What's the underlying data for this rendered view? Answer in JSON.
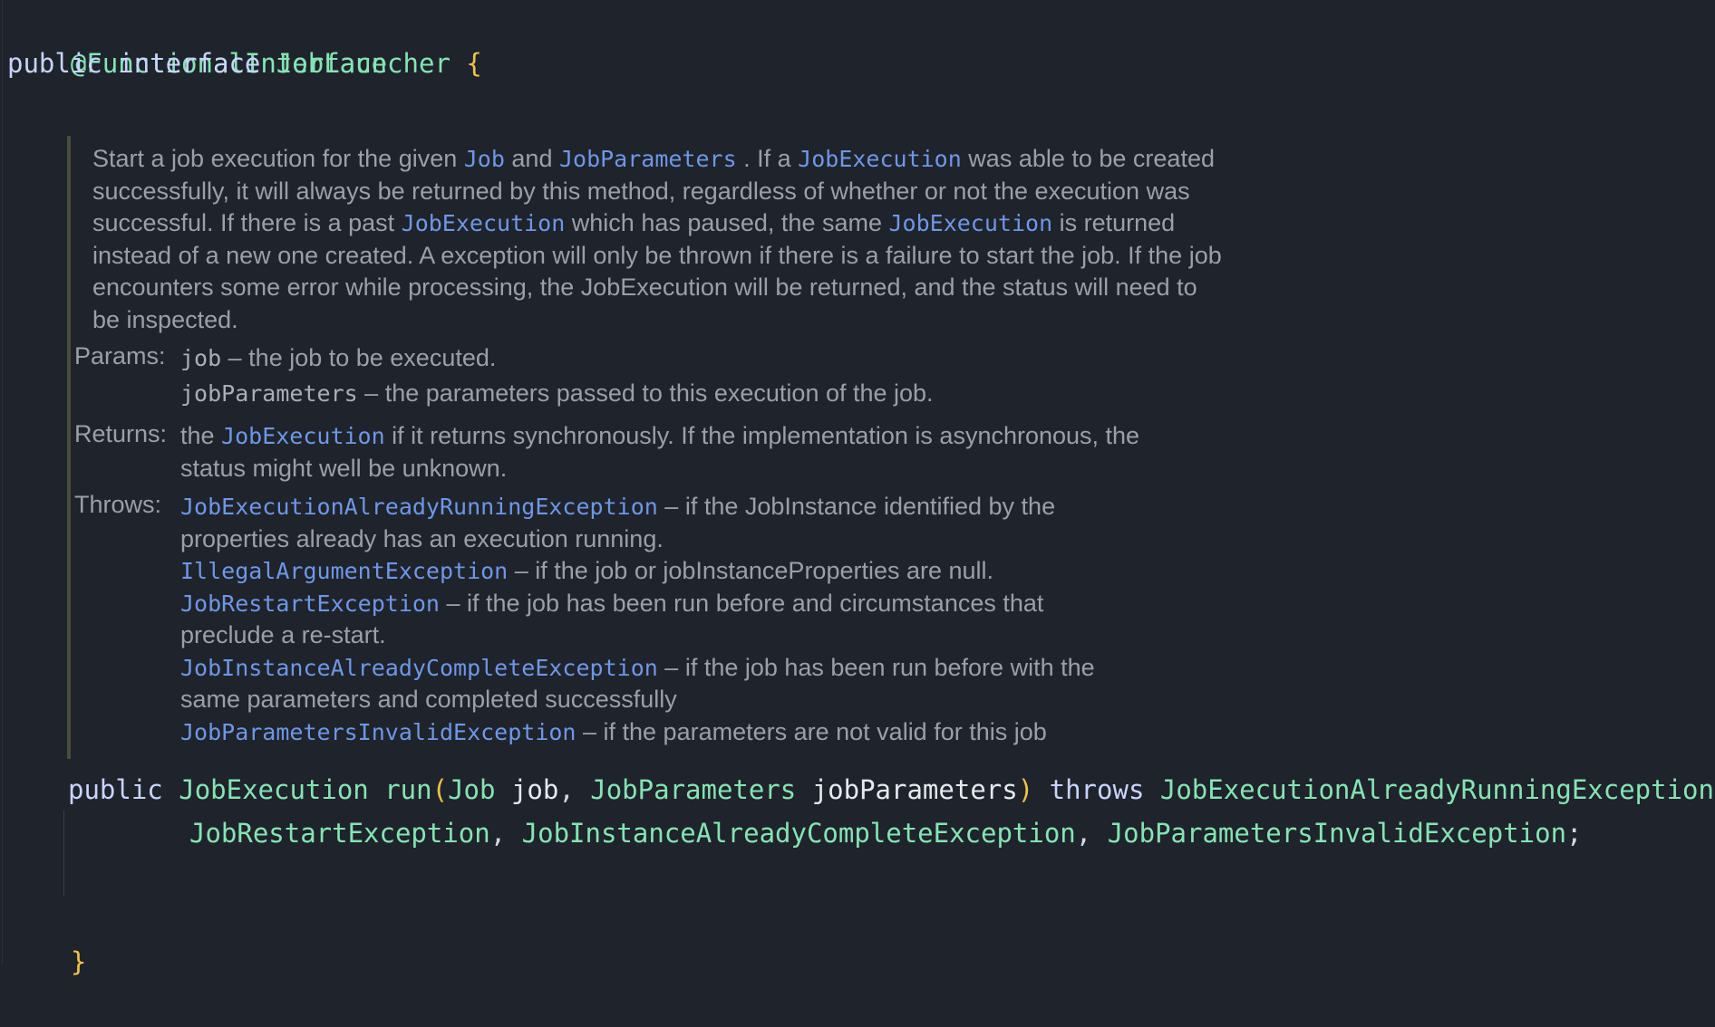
{
  "code": {
    "annotation": "@FunctionalInterface",
    "kw_public": "public",
    "kw_interface": "interface",
    "class_name": "JobLauncher",
    "open_brace": "{",
    "close_brace": "}",
    "method": {
      "kw_public": "public",
      "return_type": "JobExecution",
      "name": "run",
      "open_paren": "(",
      "param1_type": "Job",
      "param1_name": "job",
      "comma1": ",",
      "param2_type": "JobParameters",
      "param2_name": "jobParameters",
      "close_paren": ")",
      "kw_throws": "throws",
      "ex1": "JobExecutionAlreadyRunningException",
      "ex2": "JobRestartException",
      "ex3": "JobInstanceAlreadyCompleteException",
      "ex4": "JobParametersInvalidException",
      "comma": ",",
      "semicolon": ";"
    }
  },
  "doc": {
    "desc": {
      "t1": "Start a job execution for the given ",
      "l1": "Job",
      "t2": " and ",
      "l2": "JobParameters",
      "t3": " . If a ",
      "l3": "JobExecution",
      "t4": " was able to be created successfully, it will always be returned by this method, regardless of whether or not the execution was successful. If there is a past ",
      "l4": "JobExecution",
      "t5": " which has paused, the same ",
      "l5": "JobExecution",
      "t6": " is returned instead of a new one created. A exception will only be thrown if there is a failure to start the job. If the job encounters some error while processing, the JobExecution will be returned, and the status will need to be inspected."
    },
    "params": {
      "label": "Params:",
      "p1_name": "job",
      "p1_desc": " – the job to be executed.",
      "p2_name": "jobParameters",
      "p2_desc": " – the parameters passed to this execution of the job."
    },
    "returns": {
      "label": "Returns:",
      "t1": "the ",
      "link": "JobExecution",
      "t2": " if it returns synchronously. If the implementation is asynchronous, the status might well be unknown."
    },
    "throws": {
      "label": "Throws:",
      "items": [
        {
          "name": "JobExecutionAlreadyRunningException",
          "desc": " – if the JobInstance identified by the properties already has an execution running."
        },
        {
          "name": "IllegalArgumentException",
          "desc": " – if the job or jobInstanceProperties are null."
        },
        {
          "name": "JobRestartException",
          "desc": " – if the job has been run before and circumstances that preclude a re-start."
        },
        {
          "name": "JobInstanceAlreadyCompleteException",
          "desc": " – if the job has been run before with the same parameters and completed successfully"
        },
        {
          "name": "JobParametersInvalidException",
          "desc": " – if the parameters are not valid for this job"
        }
      ]
    }
  },
  "colors": {
    "background": "#1f232b",
    "keyword": "#c9d4ff",
    "type": "#86e3b5",
    "brace": "#f0c24a",
    "doc_text": "#9aa0aa",
    "doc_link": "#6f97e6"
  }
}
